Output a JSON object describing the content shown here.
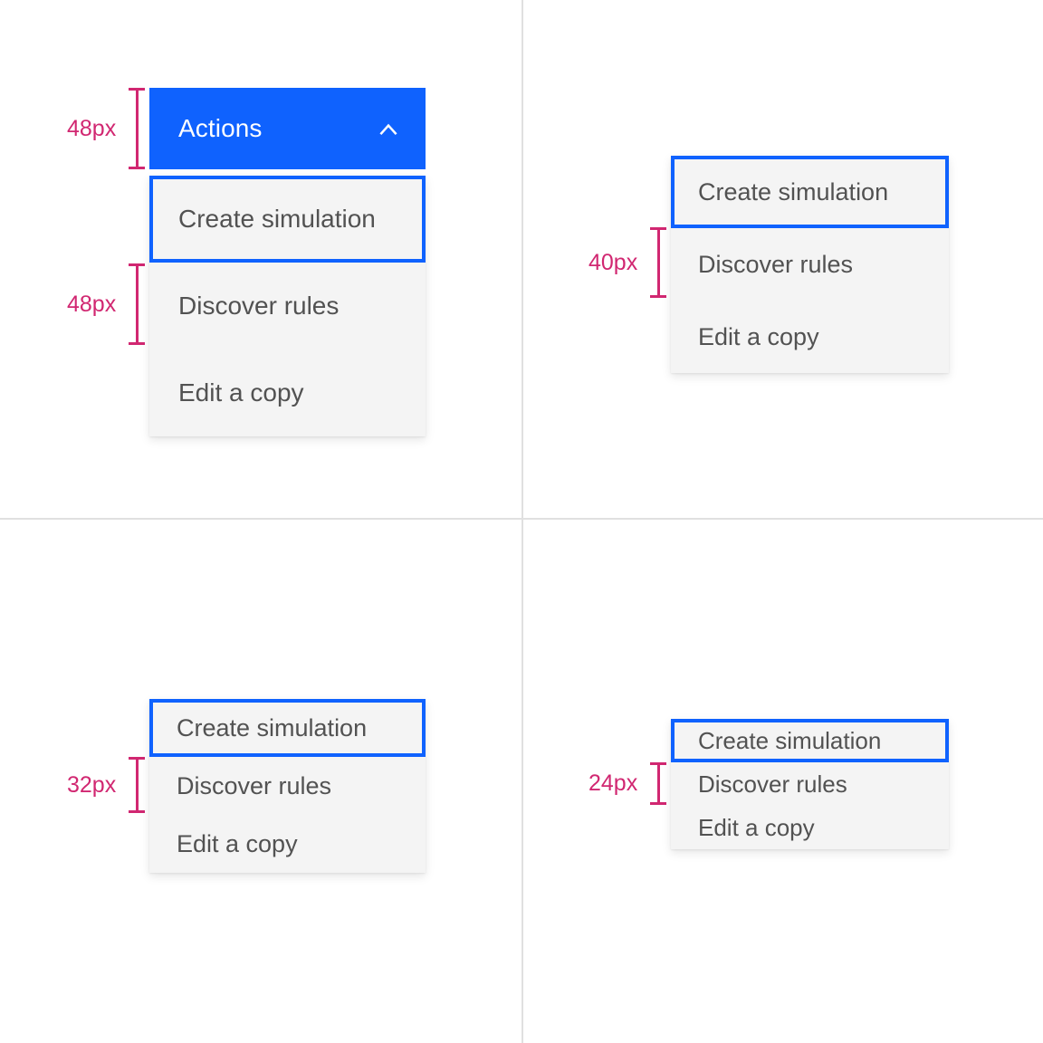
{
  "page": {
    "background": "#ffffff",
    "divider_color": "#e0e0e0"
  },
  "colors": {
    "accent_blue": "#0f62fe",
    "menu_background": "#f4f4f4",
    "menu_text": "#525252",
    "button_text": "#ffffff",
    "measure_magenta": "#d12771"
  },
  "menu_items": {
    "create": "Create simulation",
    "discover": "Discover rules",
    "edit": "Edit a copy"
  },
  "panels": [
    {
      "id": "panel-48",
      "size_label": "48px",
      "second_size_label": "48px",
      "has_trigger": true,
      "trigger_label": "Actions",
      "trigger_icon": "chevron-up-icon",
      "items": [
        "Create simulation",
        "Discover rules",
        "Edit a copy"
      ],
      "selected_index": 0
    },
    {
      "id": "panel-40",
      "size_label": "40px",
      "has_trigger": false,
      "items": [
        "Create simulation",
        "Discover rules",
        "Edit a copy"
      ],
      "selected_index": 0
    },
    {
      "id": "panel-32",
      "size_label": "32px",
      "has_trigger": false,
      "items": [
        "Create simulation",
        "Discover rules",
        "Edit a copy"
      ],
      "selected_index": 0
    },
    {
      "id": "panel-24",
      "size_label": "24px",
      "has_trigger": false,
      "items": [
        "Create simulation",
        "Discover rules",
        "Edit a copy"
      ],
      "selected_index": 0
    }
  ]
}
